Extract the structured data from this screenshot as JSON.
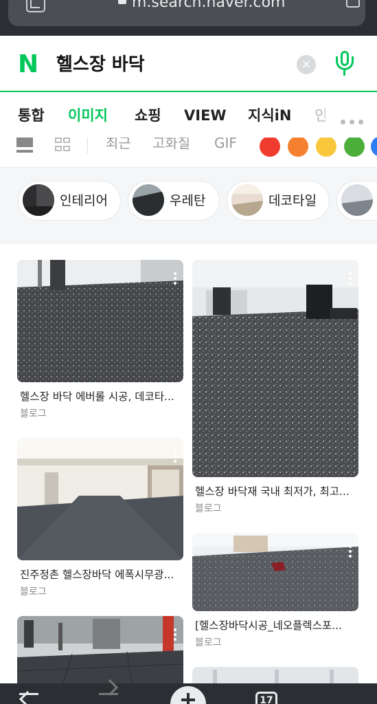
{
  "browser": {
    "url": "m.search.naver.com"
  },
  "search": {
    "logo": "N",
    "query": "헬스장 바닥",
    "clear_label": "×"
  },
  "tabs": [
    {
      "label": "통합",
      "active": false
    },
    {
      "label": "이미지",
      "active": true
    },
    {
      "label": "쇼핑",
      "active": false
    },
    {
      "label": "VIEW",
      "active": false
    },
    {
      "label": "지식iN",
      "active": false
    },
    {
      "label": "인",
      "active": false
    }
  ],
  "filters": {
    "options": [
      "최근",
      "고화질",
      "GIF"
    ],
    "colors": [
      "#f03c2e",
      "#f5802f",
      "#f8c73b",
      "#4caf3a",
      "#2f7df5"
    ]
  },
  "related_chips": [
    {
      "label": "인테리어"
    },
    {
      "label": "우레탄"
    },
    {
      "label": "데코타일"
    }
  ],
  "results": [
    {
      "title": "헬스장 바닥 에버롤 시공, 데코타...",
      "source": "블로그"
    },
    {
      "title": "헬스장 바닥재 국내 최저가, 최고...",
      "source": "블로그"
    },
    {
      "title": "진주정촌 헬스장바닥 에폭시무광...",
      "source": "블로그"
    },
    {
      "title": "[헬스장바닥시공_네오플렉스포...",
      "source": "블로그"
    }
  ],
  "bottom_bar": {
    "tab_count": "17"
  }
}
